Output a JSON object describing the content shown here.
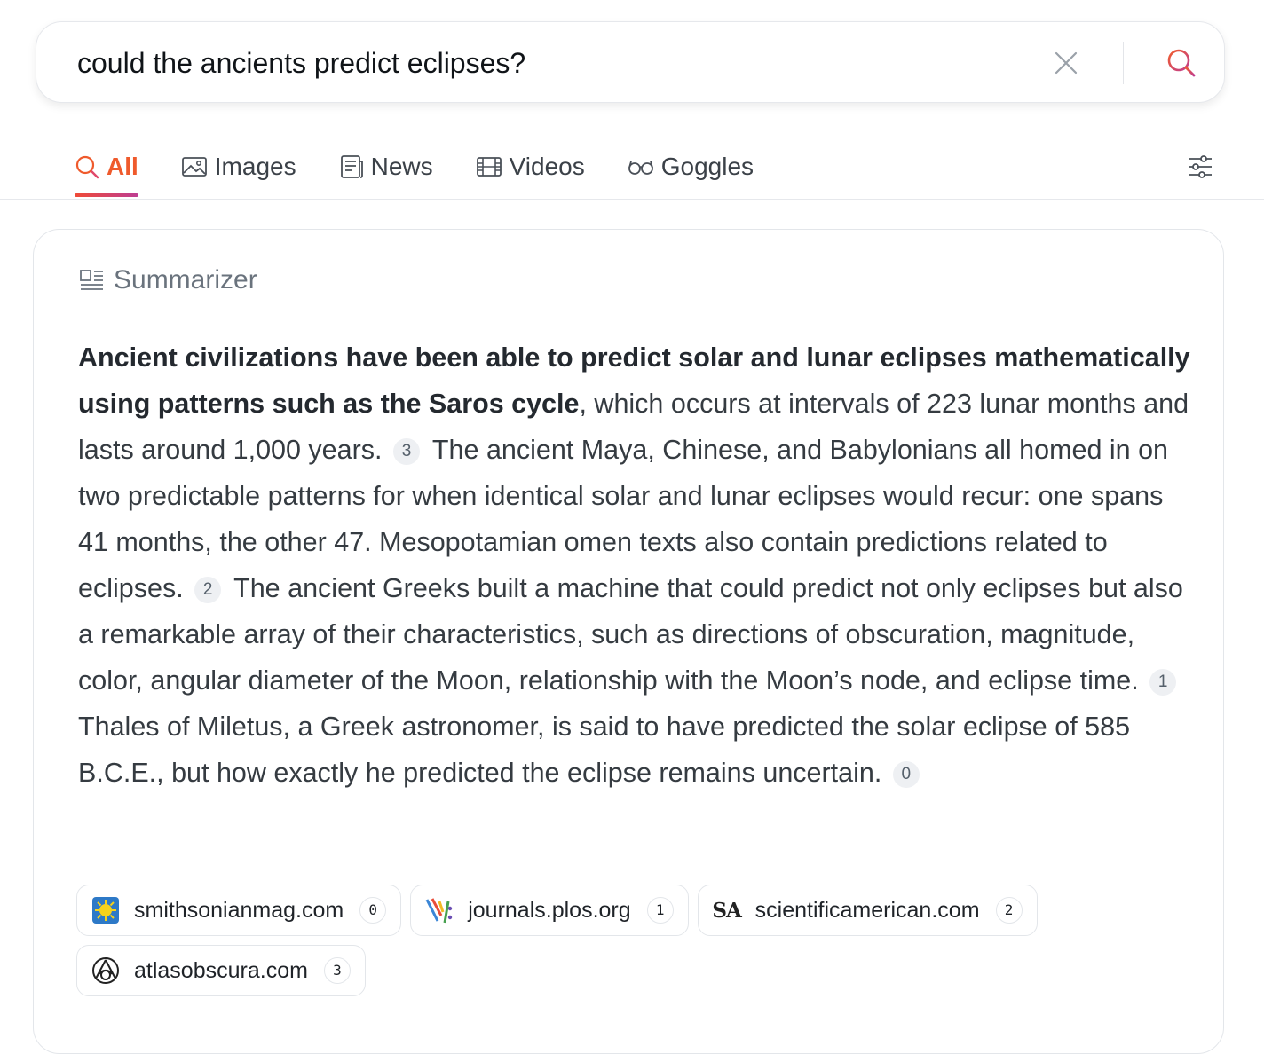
{
  "search": {
    "query": "could the ancients predict eclipses?"
  },
  "tabs": [
    {
      "label": "All",
      "icon": "search-icon",
      "active": true
    },
    {
      "label": "Images",
      "icon": "image-icon",
      "active": false
    },
    {
      "label": "News",
      "icon": "news-icon",
      "active": false
    },
    {
      "label": "Videos",
      "icon": "film-icon",
      "active": false
    },
    {
      "label": "Goggles",
      "icon": "glasses-icon",
      "active": false
    }
  ],
  "summarizer": {
    "title": "Summarizer",
    "bold_lead": "Ancient civilizations have been able to predict solar and lunar eclipses mathematically using patterns such as the Saros cycle",
    "segments": [
      {
        "text": ", which occurs at intervals of 223 lunar months and lasts around 1,000 years.",
        "cite": "3"
      },
      {
        "text": "The ancient Maya, Chinese, and Babylonians all homed in on two predictable patterns for when identical solar and lunar eclipses would recur: one spans 41 months, the other 47. Mesopotamian omen texts also contain predictions related to eclipses.",
        "cite": "2"
      },
      {
        "text": "The ancient Greeks built a machine that could predict not only eclipses but also a remarkable array of their characteristics, such as directions of obscuration, magnitude, color, angular diameter of the Moon, relationship with the Moon’s node, and eclipse time.",
        "cite": "1"
      },
      {
        "text": "Thales of Miletus, a Greek astronomer, is said to have predicted the solar eclipse of 585 B.C.E., but how exactly he predicted the eclipse remains uncertain.",
        "cite": "0"
      }
    ]
  },
  "sources": [
    {
      "name": "smithsonianmag.com",
      "num": "0",
      "icon": "sun-favicon"
    },
    {
      "name": "journals.plos.org",
      "num": "1",
      "icon": "plos-favicon"
    },
    {
      "name": "scientificamerican.com",
      "num": "2",
      "icon": "sa-favicon",
      "badge": "SA"
    },
    {
      "name": "atlasobscura.com",
      "num": "3",
      "icon": "atlas-favicon"
    }
  ],
  "colors": {
    "accent": "#ef5a2c",
    "accent_gradient_end": "#bd3d93",
    "text": "#353b41",
    "muted": "#6a737d"
  }
}
